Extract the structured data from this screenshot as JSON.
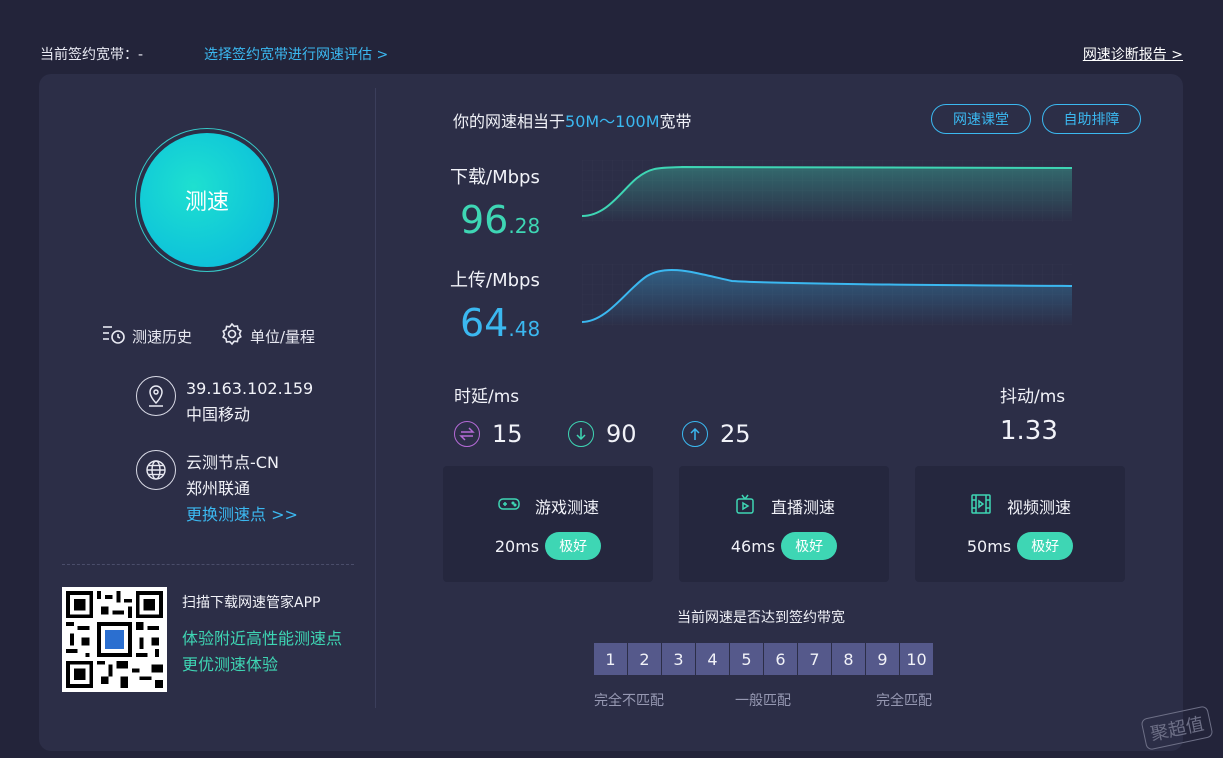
{
  "topbar": {
    "contract_label": "当前签约宽带：-",
    "select_link": "选择签约宽带进行网速评估 >",
    "report_link": "网速诊断报告 >"
  },
  "left": {
    "speed_button_label": "测速",
    "history_label": "测速历史",
    "unit_label": "单位/量程",
    "ip_address": "39.163.102.159",
    "isp": "中国移动",
    "node_name": "云测节点-CN",
    "node_isp": "郑州联通",
    "change_node_link": "更换测速点 >>",
    "scan_title": "扫描下载网速管家APP",
    "scan_line1": "体验附近高性能测速点",
    "scan_line2": "更优测速体验"
  },
  "summary": {
    "prefix": "你的网速相当于",
    "range": "50M〜100M",
    "suffix": "宽带",
    "buttons": [
      "网速课堂",
      "自助排障"
    ]
  },
  "download": {
    "label": "下载/Mbps",
    "int": "96",
    "dec": ".28"
  },
  "upload": {
    "label": "上传/Mbps",
    "int": "64",
    "dec": ".48"
  },
  "latency": {
    "title": "时延/ms",
    "items": [
      {
        "icon": "swap-icon",
        "value": "15",
        "color": "#b46ad6"
      },
      {
        "icon": "arrow-down-icon",
        "value": "90",
        "color": "#3ed6b4"
      },
      {
        "icon": "arrow-up-icon",
        "value": "25",
        "color": "#3bb8f0"
      }
    ]
  },
  "jitter": {
    "title": "抖动/ms",
    "value": "1.33"
  },
  "cards": [
    {
      "icon": "gamepad-icon",
      "title": "游戏测速",
      "value": "20ms",
      "badge": "极好"
    },
    {
      "icon": "tv-icon",
      "title": "直播测速",
      "value": "46ms",
      "badge": "极好"
    },
    {
      "icon": "film-icon",
      "title": "视频测速",
      "value": "50ms",
      "badge": "极好"
    }
  ],
  "match": {
    "title": "当前网速是否达到签约带宽",
    "cells": [
      "1",
      "2",
      "3",
      "4",
      "5",
      "6",
      "7",
      "8",
      "9",
      "10"
    ],
    "labels": [
      "完全不匹配",
      "一般匹配",
      "完全匹配"
    ]
  },
  "watermark": "聚超值",
  "colors": {
    "accent_green": "#3ed6b4",
    "accent_blue": "#3bb8f0",
    "panel_bg": "#2c2e47",
    "page_bg": "#23243a"
  }
}
